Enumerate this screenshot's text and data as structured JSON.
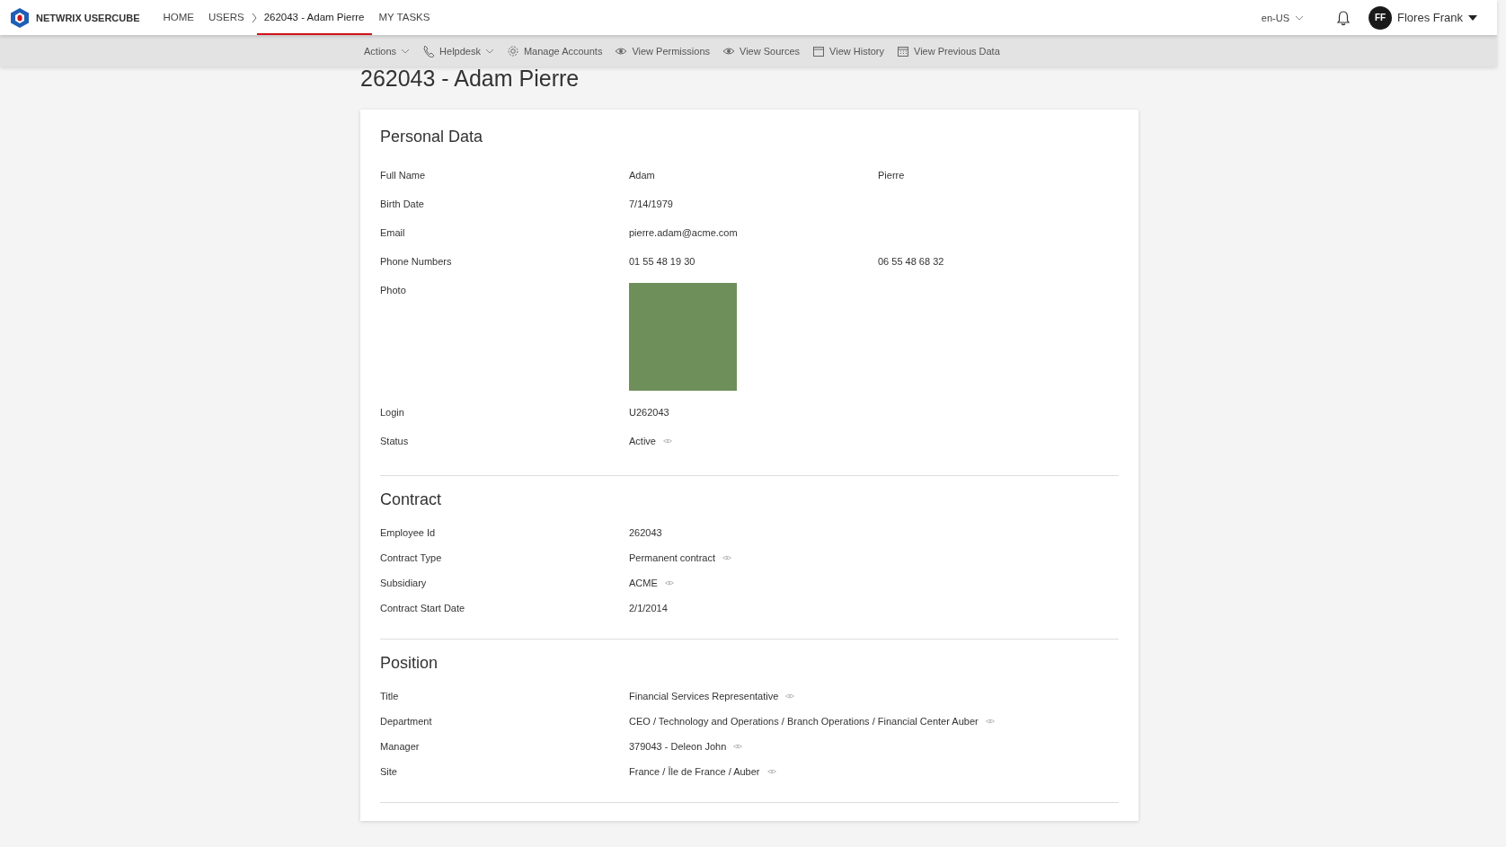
{
  "header": {
    "brand": "NETWRIX USERCUBE",
    "nav": [
      {
        "label": "HOME",
        "kind": "link",
        "selected": false
      },
      {
        "label": "USERS",
        "kind": "crumb",
        "selected": false
      },
      {
        "label": "262043 - Adam Pierre",
        "kind": "link",
        "selected": true
      },
      {
        "label": "MY TASKS",
        "kind": "link",
        "selected": false
      }
    ],
    "language": "en-US",
    "user": {
      "initials": "FF",
      "name": "Flores Frank"
    }
  },
  "toolbar": [
    {
      "label": "Actions",
      "dropdown": true
    },
    {
      "label": "Helpdesk",
      "dropdown": true
    },
    {
      "label": "Manage Accounts",
      "dropdown": false
    },
    {
      "label": "View Permissions",
      "dropdown": false
    },
    {
      "label": "View Sources",
      "dropdown": false
    },
    {
      "label": "View History",
      "dropdown": false
    },
    {
      "label": "View Previous Data",
      "dropdown": false
    }
  ],
  "page_title": "262043 - Adam Pierre",
  "sections": [
    {
      "title": "Personal Data",
      "fields": [
        {
          "label": "Full Name",
          "kind": "text",
          "values": [
            "Adam",
            "Pierre"
          ],
          "viewable": false
        },
        {
          "label": "Birth Date",
          "kind": "text",
          "values": [
            "7/14/1979"
          ],
          "viewable": false
        },
        {
          "label": "Email",
          "kind": "text",
          "values": [
            "pierre.adam@acme.com"
          ],
          "viewable": false
        },
        {
          "label": "Phone Numbers",
          "kind": "text",
          "values": [
            "01 55 48 19 30",
            "06 55 48 68 32"
          ],
          "viewable": false
        },
        {
          "label": "Photo",
          "kind": "photo",
          "viewable": false
        },
        {
          "label": "Login",
          "kind": "text",
          "values": [
            "U262043"
          ],
          "viewable": false
        },
        {
          "label": "Status",
          "kind": "text",
          "values": [
            "Active"
          ],
          "viewable": true
        }
      ]
    },
    {
      "title": "Contract",
      "fields": [
        {
          "label": "Employee Id",
          "kind": "text",
          "values": [
            "262043"
          ],
          "viewable": false
        },
        {
          "label": "Contract Type",
          "kind": "text",
          "values": [
            "Permanent contract"
          ],
          "viewable": true
        },
        {
          "label": "Subsidiary",
          "kind": "text",
          "values": [
            "ACME"
          ],
          "viewable": true
        },
        {
          "label": "Contract Start Date",
          "kind": "text",
          "values": [
            "2/1/2014"
          ],
          "viewable": false
        }
      ]
    },
    {
      "title": "Position",
      "fields": [
        {
          "label": "Title",
          "kind": "text",
          "values": [
            "Financial Services Representative"
          ],
          "viewable": true
        },
        {
          "label": "Department",
          "kind": "text",
          "values": [
            "CEO / Technology and Operations / Branch Operations / Financial Center Auber"
          ],
          "viewable": true
        },
        {
          "label": "Manager",
          "kind": "text",
          "values": [
            "379043 - Deleon John"
          ],
          "viewable": true
        },
        {
          "label": "Site",
          "kind": "text",
          "values": [
            "France / Île de France / Auber"
          ],
          "viewable": true
        }
      ]
    }
  ]
}
